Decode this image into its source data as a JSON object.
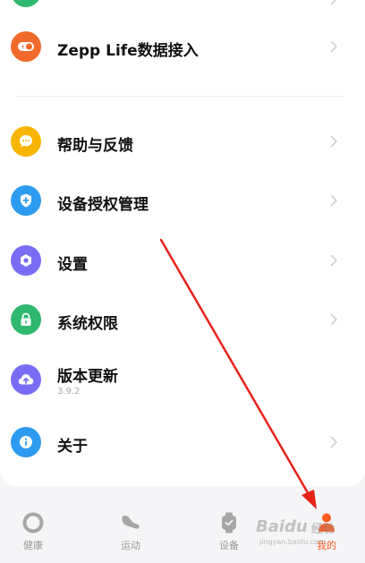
{
  "menu": {
    "items": [
      {
        "id": "zepp",
        "label": "Zepp Life数据接入",
        "icon": "toggle-icon",
        "color": "#f26a2b"
      },
      {
        "id": "help",
        "label": "帮助与反馈",
        "icon": "chat-bubble-icon",
        "color": "#f7b500"
      },
      {
        "id": "auth",
        "label": "设备授权管理",
        "icon": "shield-plus-icon",
        "color": "#2d9cf0"
      },
      {
        "id": "settings",
        "label": "设置",
        "icon": "hexagon-icon",
        "color": "#7b6cf6"
      },
      {
        "id": "permissions",
        "label": "系统权限",
        "icon": "lock-icon",
        "color": "#2fb86e"
      },
      {
        "id": "update",
        "label": "版本更新",
        "sublabel": "3.9.2",
        "icon": "cloud-upload-icon",
        "color": "#7b6cf6"
      },
      {
        "id": "about",
        "label": "关于",
        "icon": "info-icon",
        "color": "#2d9cf0"
      }
    ]
  },
  "tabbar": {
    "tabs": [
      {
        "label": "健康",
        "icon": "ring-icon",
        "active": false
      },
      {
        "label": "运动",
        "icon": "shoe-icon",
        "active": false
      },
      {
        "label": "设备",
        "icon": "watch-icon",
        "active": false
      },
      {
        "label": "我的",
        "icon": "profile-icon",
        "active": true
      }
    ]
  },
  "watermark": {
    "logo": "Baidu",
    "sub": "经验",
    "url": "jingyan.baidu.com"
  },
  "colors": {
    "accent": "#ff5a1f",
    "annotation_arrow": "#e8231b"
  }
}
